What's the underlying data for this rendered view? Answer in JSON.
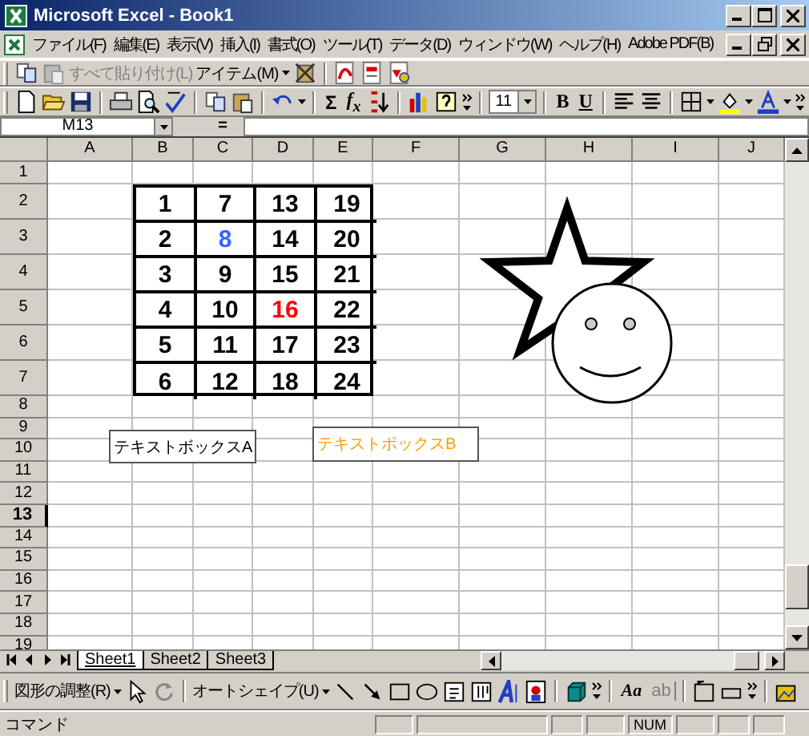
{
  "window": {
    "title": "Microsoft Excel - Book1"
  },
  "menu": [
    {
      "label": "ファイル(F)"
    },
    {
      "label": "編集(E)"
    },
    {
      "label": "表示(V)"
    },
    {
      "label": "挿入(I)"
    },
    {
      "label": "書式(O)"
    },
    {
      "label": "ツール(T)"
    },
    {
      "label": "データ(D)"
    },
    {
      "label": "ウィンドウ(W)"
    },
    {
      "label": "ヘルプ(H)"
    },
    {
      "label": "Adobe PDF(B)"
    }
  ],
  "toolbar_1": {
    "paste_all": {
      "label": "すべて貼り付け(L)",
      "disabled": true
    },
    "items_menu": {
      "label": "アイテム(M)",
      "disabled": false
    }
  },
  "toolbar_2": {
    "sum": "Σ",
    "function": "f$_{x}$",
    "font_size": "11",
    "bold": "B",
    "underline": "U"
  },
  "formula_bar": {
    "name_box": "M13",
    "equals": "="
  },
  "sheet": {
    "columns": [
      "A",
      "B",
      "C",
      "D",
      "E",
      "F",
      "G",
      "H",
      "I",
      "J"
    ],
    "rows": [
      {
        "label": "1",
        "selected": false
      },
      {
        "label": "2",
        "selected": false
      },
      {
        "label": "3",
        "selected": false
      },
      {
        "label": "4",
        "selected": false
      },
      {
        "label": "5",
        "selected": false
      },
      {
        "label": "6",
        "selected": false
      },
      {
        "label": "7",
        "selected": false
      },
      {
        "label": "8",
        "selected": false
      },
      {
        "label": "9",
        "selected": false
      },
      {
        "label": "10",
        "selected": false
      },
      {
        "label": "11",
        "selected": false
      },
      {
        "label": "12",
        "selected": false
      },
      {
        "label": "13",
        "selected": true
      },
      {
        "label": "14",
        "selected": false
      },
      {
        "label": "15",
        "selected": false
      },
      {
        "label": "16",
        "selected": false
      },
      {
        "label": "17",
        "selected": false
      },
      {
        "label": "18",
        "selected": false
      },
      {
        "label": "19",
        "selected": false
      }
    ],
    "number_table": [
      [
        {
          "text": "1",
          "color": "#000000"
        },
        {
          "text": "7",
          "color": "#000000"
        },
        {
          "text": "13",
          "color": "#000000"
        },
        {
          "text": "19",
          "color": "#000000"
        }
      ],
      [
        {
          "text": "2",
          "color": "#000000"
        },
        {
          "text": "8",
          "color": "#3366ff"
        },
        {
          "text": "14",
          "color": "#000000"
        },
        {
          "text": "20",
          "color": "#000000"
        }
      ],
      [
        {
          "text": "3",
          "color": "#000000"
        },
        {
          "text": "9",
          "color": "#000000"
        },
        {
          "text": "15",
          "color": "#000000"
        },
        {
          "text": "21",
          "color": "#000000"
        }
      ],
      [
        {
          "text": "4",
          "color": "#000000"
        },
        {
          "text": "10",
          "color": "#000000"
        },
        {
          "text": "16",
          "color": "#ff0000"
        },
        {
          "text": "22",
          "color": "#000000"
        }
      ],
      [
        {
          "text": "5",
          "color": "#000000"
        },
        {
          "text": "11",
          "color": "#000000"
        },
        {
          "text": "17",
          "color": "#000000"
        },
        {
          "text": "23",
          "color": "#000000"
        }
      ],
      [
        {
          "text": "6",
          "color": "#000000"
        },
        {
          "text": "12",
          "color": "#000000"
        },
        {
          "text": "18",
          "color": "#000000"
        },
        {
          "text": "24",
          "color": "#000000"
        }
      ]
    ],
    "text_boxes": [
      {
        "text": "テキストボックスA",
        "color": "#000000"
      },
      {
        "text": "テキストボックスB",
        "color": "#ff9900"
      }
    ]
  },
  "sheet_tabs": [
    {
      "label": "Sheet1",
      "selected": true
    },
    {
      "label": "Sheet2",
      "selected": false
    },
    {
      "label": "Sheet3",
      "selected": false
    }
  ],
  "drawing_toolbar": {
    "draw_menu": "図形の調整(R)",
    "autoshapes_menu": "オートシェイプ(U)",
    "font_label": "Aa",
    "field_label": "ab",
    "field_disabled": true
  },
  "status_bar": {
    "mode": "コマンド",
    "num_lock": "NUM"
  }
}
